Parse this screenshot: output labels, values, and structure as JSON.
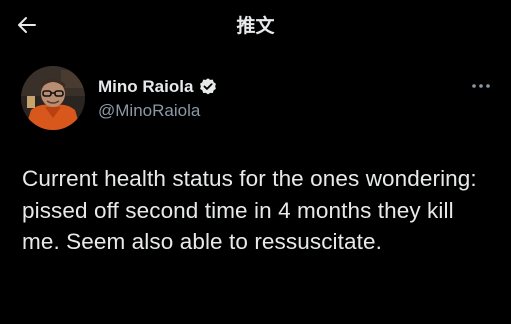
{
  "header": {
    "title": "推文",
    "back_icon": "arrow-left-icon"
  },
  "tweet": {
    "author": {
      "display_name": "Mino Raiola",
      "handle": "@MinoRaiola",
      "verified": true,
      "verified_icon": "verified-badge-icon",
      "avatar_icon": "profile-photo"
    },
    "more_icon": "more-horizontal-icon",
    "text": "Current health status for the ones wondering: pissed off second time in 4 months they kill me. Seem also able to ressuscitate."
  },
  "colors": {
    "background": "#000000",
    "primary_text": "#e7e9ea",
    "secondary_text": "#8b98a5",
    "badge": "#e7e9ea"
  }
}
